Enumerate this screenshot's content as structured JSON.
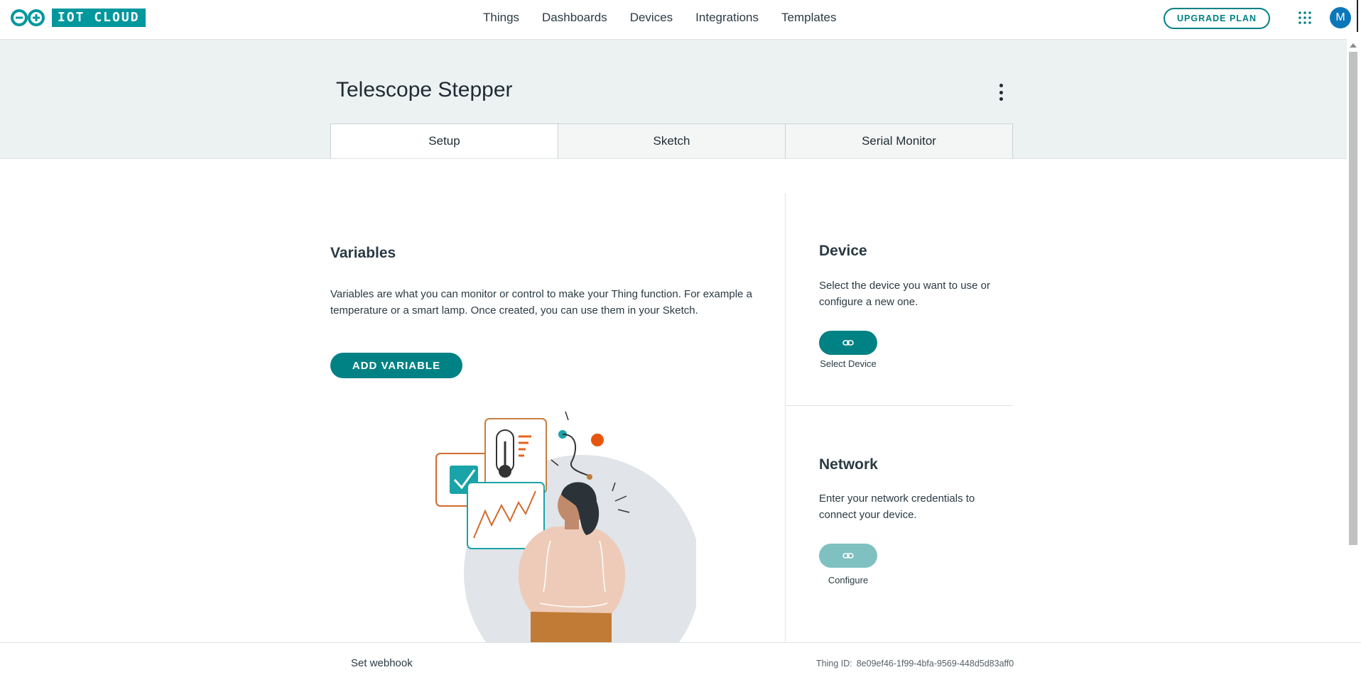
{
  "header": {
    "logo_text": "IOT CLOUD",
    "nav": [
      "Things",
      "Dashboards",
      "Devices",
      "Integrations",
      "Templates"
    ],
    "upgrade_label": "UPGRADE PLAN",
    "avatar_initial": "M",
    "apps_icon": "grid-icon"
  },
  "thing": {
    "title": "Telescope Stepper",
    "menu_icon": "kebab-icon"
  },
  "tabs": [
    {
      "label": "Setup",
      "active": true
    },
    {
      "label": "Sketch",
      "active": false
    },
    {
      "label": "Serial Monitor",
      "active": false
    }
  ],
  "variables": {
    "title": "Variables",
    "description": "Variables are what you can monitor or control to make your Thing function. For example a temperature or a smart lamp. Once created, you can use them in your Sketch.",
    "add_label": "ADD VARIABLE"
  },
  "device": {
    "title": "Device",
    "description": "Select the device you want to use or configure a new one.",
    "button_caption": "Select Device",
    "icon": "link-icon"
  },
  "network": {
    "title": "Network",
    "description": "Enter your network credentials to connect your device.",
    "button_caption": "Configure",
    "icon": "link-icon"
  },
  "footer": {
    "webhook_label": "Set webhook",
    "thing_id_label": "Thing ID:",
    "thing_id_value": "8e09ef46-1f99-4bfa-9569-448d5d83aff0"
  },
  "colors": {
    "accent": "#008184",
    "logo_teal": "#00979d",
    "band_bg": "#ecf1f1",
    "avatar": "#0c77b8"
  }
}
